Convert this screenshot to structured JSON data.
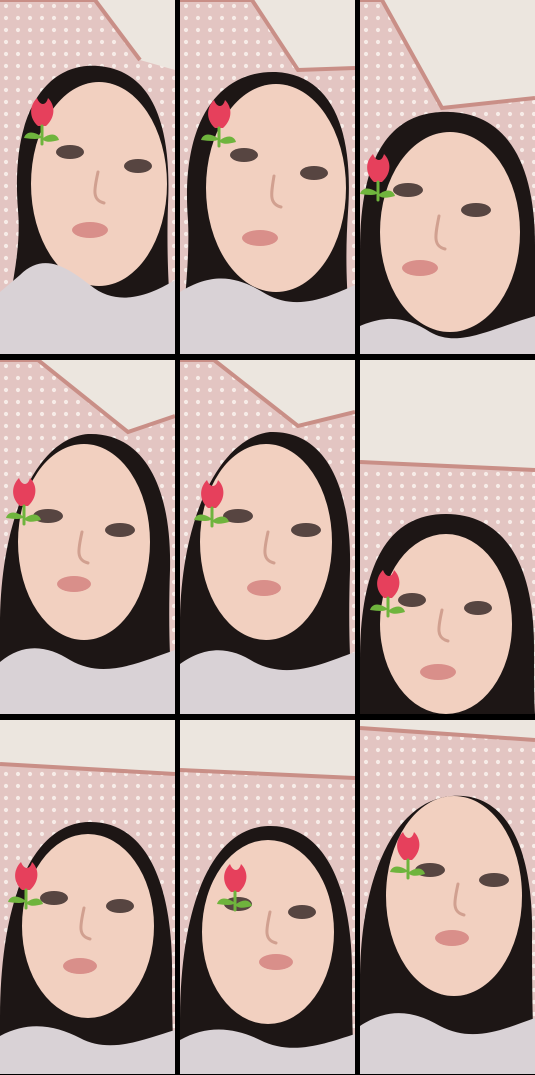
{
  "collage": {
    "tile_count": 9,
    "tiles": [
      {
        "index": 1,
        "emoji": "🌷"
      },
      {
        "index": 2,
        "emoji": "🌷"
      },
      {
        "index": 3,
        "emoji": "🌷"
      },
      {
        "index": 4,
        "emoji": "🌷"
      },
      {
        "index": 5,
        "emoji": "🌷"
      },
      {
        "index": 6,
        "emoji": "🌷"
      },
      {
        "index": 7,
        "emoji": "🌷"
      },
      {
        "index": 8,
        "emoji": "🌷"
      },
      {
        "index": 9,
        "emoji": "🌷"
      }
    ]
  },
  "colors": {
    "border": "#000000",
    "wall": "#ece6df",
    "curtain": "#e3c3c0",
    "curtain_dots": "#f8ece8",
    "skin": "#f2d0c0",
    "hair": "#1d1615",
    "lips": "#d98f8a",
    "tulip": "#e6405c",
    "leaf": "#6fb43d",
    "shirt": "#d9d2d6"
  }
}
